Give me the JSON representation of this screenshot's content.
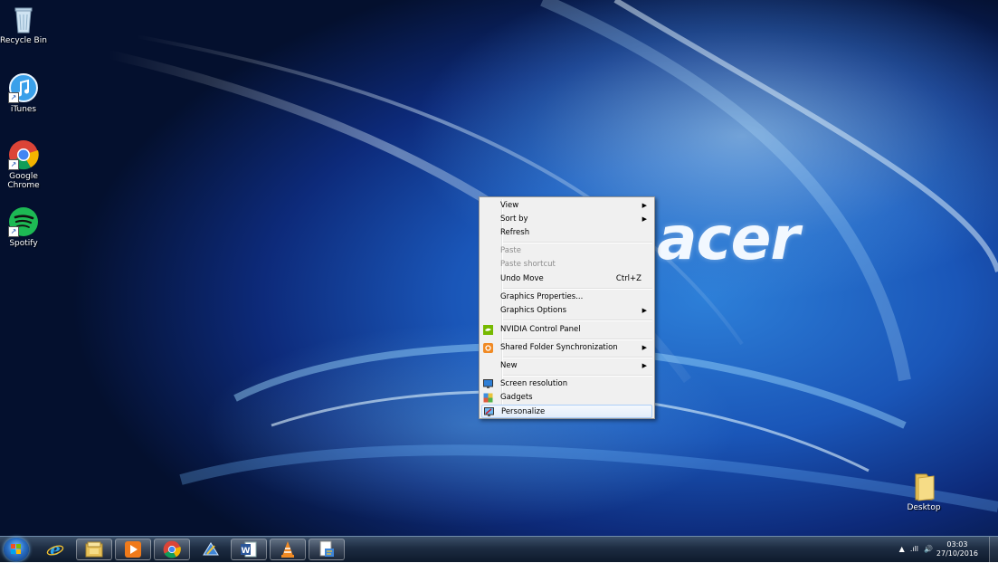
{
  "desktop": {
    "icons": [
      {
        "label": "Recycle Bin",
        "icon": "recycle-bin-icon"
      },
      {
        "label": "iTunes",
        "icon": "itunes-icon"
      },
      {
        "label": "Google Chrome",
        "icon": "chrome-icon"
      },
      {
        "label": "Spotify",
        "icon": "spotify-icon"
      },
      {
        "label": "Desktop",
        "icon": "folder-icon"
      }
    ],
    "wallpaper_logo": "acer"
  },
  "context_menu": {
    "items": [
      {
        "label": "View",
        "submenu": true
      },
      {
        "label": "Sort by",
        "submenu": true
      },
      {
        "label": "Refresh"
      },
      {
        "label": "Paste",
        "disabled": true
      },
      {
        "label": "Paste shortcut",
        "disabled": true
      },
      {
        "label": "Undo Move",
        "accelerator": "Ctrl+Z"
      },
      {
        "label": "Graphics Properties..."
      },
      {
        "label": "Graphics Options",
        "submenu": true
      },
      {
        "label": "NVIDIA Control Panel",
        "icon": "nvidia-icon"
      },
      {
        "label": "Shared Folder Synchronization",
        "icon": "sync-icon",
        "submenu": true
      },
      {
        "label": "New",
        "submenu": true
      },
      {
        "label": "Screen resolution",
        "icon": "display-icon"
      },
      {
        "label": "Gadgets",
        "icon": "gadgets-icon"
      },
      {
        "label": "Personalize",
        "icon": "personalize-icon",
        "highlighted": true
      }
    ],
    "submenu_glyph": "▶"
  },
  "taskbar": {
    "start_icon": "windows-start-icon",
    "buttons": [
      {
        "icon": "internet-explorer-icon",
        "open": false
      },
      {
        "icon": "file-explorer-icon",
        "open": true
      },
      {
        "icon": "media-player-icon",
        "open": true
      },
      {
        "icon": "chrome-icon",
        "open": true
      },
      {
        "icon": "app-icon",
        "open": false
      },
      {
        "icon": "word-icon",
        "open": true
      },
      {
        "icon": "vlc-icon",
        "open": true
      },
      {
        "icon": "program-icon",
        "open": true
      }
    ],
    "tray": {
      "overflow_glyph": "▲",
      "signal_glyph": ".ıll",
      "volume_glyph": "🔊",
      "time": "03:03",
      "date": "27/10/2016"
    }
  }
}
